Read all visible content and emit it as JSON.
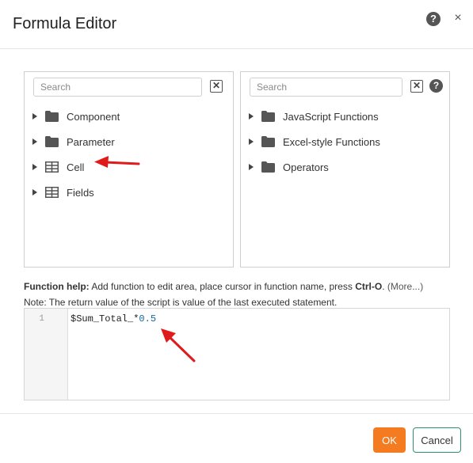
{
  "dialog": {
    "title": "Formula Editor",
    "help_glyph": "?",
    "close_glyph": "×"
  },
  "left_panel": {
    "search_placeholder": "Search",
    "clear_glyph": "✕",
    "items": [
      {
        "label": "Component",
        "icon": "folder-icon"
      },
      {
        "label": "Parameter",
        "icon": "folder-icon"
      },
      {
        "label": "Cell",
        "icon": "table-icon"
      },
      {
        "label": "Fields",
        "icon": "table-icon"
      }
    ]
  },
  "right_panel": {
    "search_placeholder": "Search",
    "clear_glyph": "✕",
    "help_glyph": "?",
    "items": [
      {
        "label": "JavaScript Functions",
        "icon": "folder-icon"
      },
      {
        "label": "Excel-style Functions",
        "icon": "folder-icon"
      },
      {
        "label": "Operators",
        "icon": "folder-icon"
      }
    ]
  },
  "function_help": {
    "label": "Function help:",
    "text": " Add function to edit area, place cursor in function name, press ",
    "shortcut": "Ctrl-O",
    "after_shortcut": ". ",
    "more_link": "(More...)",
    "note": "Note: The return value of the script is value of the last executed statement."
  },
  "editor": {
    "line_number": "1",
    "code_var": "$Sum_Total_*",
    "code_num": "0.5"
  },
  "footer": {
    "ok_label": "OK",
    "cancel_label": "Cancel"
  },
  "colors": {
    "accent": "#f47b20",
    "cancel_border": "#2f8f73",
    "annotation_arrow": "#e01b1b",
    "folder": "#555555"
  }
}
